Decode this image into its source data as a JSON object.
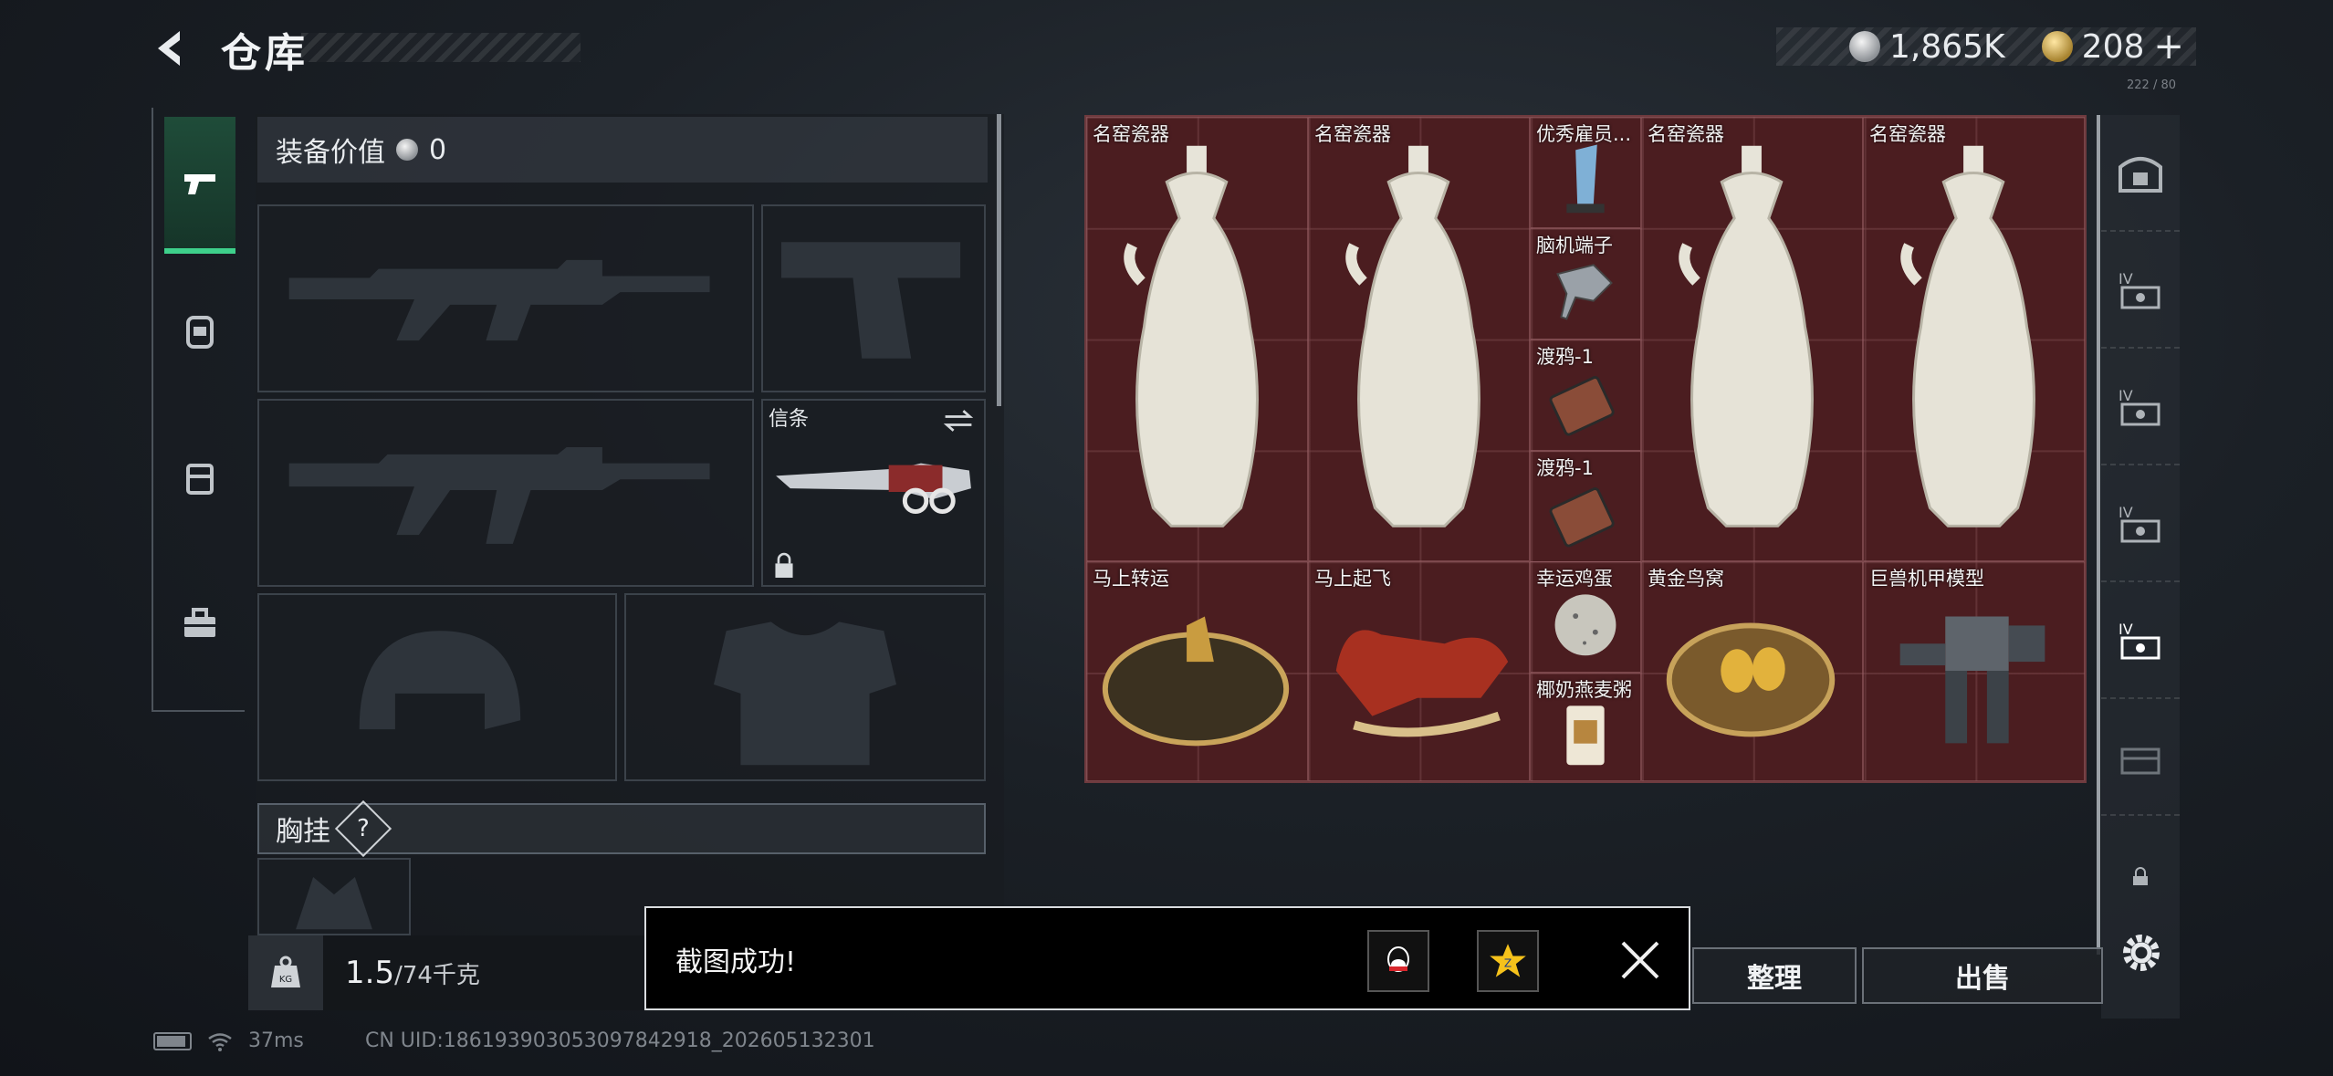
{
  "header": {
    "title": "仓库",
    "back_icon": "back-arrow-icon",
    "tiny_code": "222 / 80",
    "currency": {
      "silver_amount": "1,865K",
      "gold_amount": "208",
      "add_symbol": "+"
    }
  },
  "left_categories": [
    {
      "name": "pistol-icon",
      "active": true
    },
    {
      "name": "backpack-armor-icon",
      "active": false
    },
    {
      "name": "backpack-icon",
      "active": false
    },
    {
      "name": "toolbox-icon",
      "active": false
    }
  ],
  "equipment": {
    "value_label": "装备价值",
    "value": "0",
    "melee_label": "信条",
    "chest_label": "胸挂",
    "chest_help": "?"
  },
  "weight": {
    "icon_label": "KG",
    "current": "1.5",
    "max": "/74千克",
    "fill_fraction": 0.02
  },
  "grid_items": [
    {
      "name": "名窑瓷器"
    },
    {
      "name": "名窑瓷器"
    },
    {
      "name": "优秀雇员..."
    },
    {
      "name": "脑机端子"
    },
    {
      "name": "渡鸦-1"
    },
    {
      "name": "渡鸦-1"
    },
    {
      "name": "名窑瓷器"
    },
    {
      "name": "名窑瓷器"
    },
    {
      "name": "马上转运"
    },
    {
      "name": "马上起飞"
    },
    {
      "name": "幸运鸡蛋"
    },
    {
      "name": "椰奶燕麦粥"
    },
    {
      "name": "黄金鸟窝"
    },
    {
      "name": "巨兽机甲模型"
    }
  ],
  "right_tabs": [
    {
      "name": "safe-box-icon"
    },
    {
      "name": "storage-iv-icon"
    },
    {
      "name": "storage-iv-icon"
    },
    {
      "name": "storage-iv-icon"
    },
    {
      "name": "storage-iv-icon",
      "active": true
    },
    {
      "name": "storage-locked-icon"
    },
    {
      "name": "lock-small-icon"
    }
  ],
  "buttons": {
    "sort": "整理",
    "sell": "出售"
  },
  "toast": {
    "message": "截图成功!",
    "share_qq": "qq-icon",
    "share_qzone": "qzone-star-icon",
    "close": "close-icon"
  },
  "status": {
    "ping": "37ms",
    "uid": "CN UID:1861939030530978429​18_202605132301",
    "battery_level": 0.9
  },
  "colors": {
    "grid_bg": "#4b1d20",
    "active_tab": "#3ed08b"
  }
}
